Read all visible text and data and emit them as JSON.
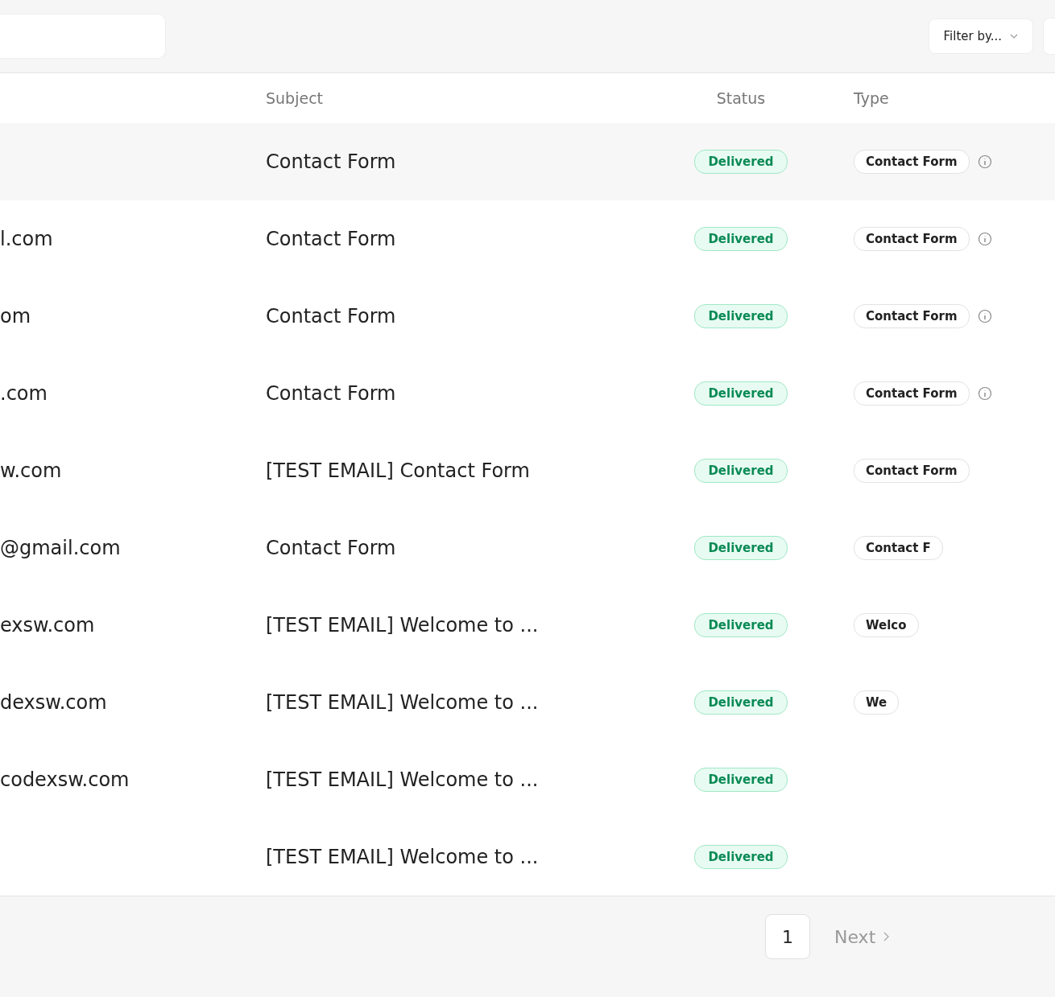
{
  "toolbar": {
    "filter": {
      "label": "Filter by..."
    }
  },
  "table": {
    "columns": [
      "Subject",
      "Status",
      "Type"
    ],
    "rows": [
      {
        "email": "",
        "subject": "Contact Form",
        "status": "Delivered",
        "type": "Contact Form",
        "info": true,
        "highlighted": true
      },
      {
        "email": "l.com",
        "subject": "Contact Form",
        "status": "Delivered",
        "type": "Contact Form",
        "info": true,
        "highlighted": false
      },
      {
        "email": "om",
        "subject": "Contact Form",
        "status": "Delivered",
        "type": "Contact Form",
        "info": true,
        "highlighted": false
      },
      {
        "email": ".com",
        "subject": "Contact Form",
        "status": "Delivered",
        "type": "Contact Form",
        "info": true,
        "highlighted": false
      },
      {
        "email": "w.com",
        "subject": "[TEST EMAIL] Contact Form",
        "status": "Delivered",
        "type": "Contact Form",
        "info": false,
        "highlighted": false
      },
      {
        "email": "@gmail.com",
        "subject": "Contact Form",
        "status": "Delivered",
        "type": "Contact F",
        "info": false,
        "highlighted": false
      },
      {
        "email": "exsw.com",
        "subject": "[TEST EMAIL] Welcome to ...",
        "status": "Delivered",
        "type": "Welco",
        "info": false,
        "highlighted": false
      },
      {
        "email": "dexsw.com",
        "subject": "[TEST EMAIL] Welcome to ...",
        "status": "Delivered",
        "type": "We",
        "info": false,
        "highlighted": false
      },
      {
        "email": "codexsw.com",
        "subject": "[TEST EMAIL] Welcome to ...",
        "status": "Delivered",
        "type": "",
        "info": false,
        "highlighted": false
      },
      {
        "email": "",
        "subject": "[TEST EMAIL] Welcome to ...",
        "status": "Delivered",
        "type": "",
        "info": false,
        "highlighted": false
      }
    ]
  },
  "pagination": {
    "page": "1",
    "next": "Next"
  }
}
